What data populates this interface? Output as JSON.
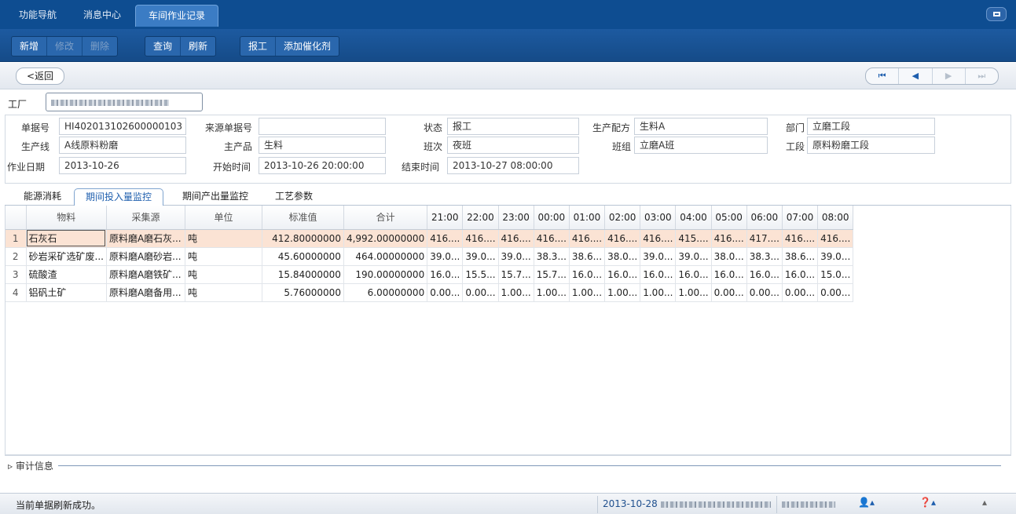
{
  "top_tabs": [
    "功能导航",
    "消息中心",
    "车间作业记录"
  ],
  "toolbar": {
    "group1": [
      {
        "label": "新增",
        "enabled": true
      },
      {
        "label": "修改",
        "enabled": false
      },
      {
        "label": "删除",
        "enabled": false
      }
    ],
    "group2": [
      {
        "label": "查询",
        "enabled": true
      },
      {
        "label": "刷新",
        "enabled": true
      }
    ],
    "group3": [
      {
        "label": "报工",
        "enabled": true
      },
      {
        "label": "添加催化剂",
        "enabled": true
      }
    ]
  },
  "nav": {
    "back_label": "<返回",
    "pager": [
      "⏮",
      "◀",
      "▶",
      "⏭"
    ]
  },
  "factory": {
    "label": "工厂"
  },
  "form": {
    "doc_no_label": "单据号",
    "doc_no": "HI402013102600000103",
    "source_no_label": "来源单据号",
    "source_no": "",
    "status_label": "状态",
    "status": "报工",
    "recipe_label": "生产配方",
    "recipe": "生料A",
    "dept_label": "部门",
    "dept": "立磨工段",
    "line_label": "生产线",
    "line": "A线原料粉磨",
    "product_label": "主产品",
    "product": "生料",
    "shift_label": "班次",
    "shift": "夜班",
    "team_label": "班组",
    "team": "立磨A班",
    "section_label": "工段",
    "section": "原料粉磨工段",
    "date_label": "作业日期",
    "date": "2013-10-26",
    "start_label": "开始时间",
    "start": "2013-10-26 20:00:00",
    "end_label": "结束时间",
    "end": "2013-10-27 08:00:00"
  },
  "sub_tabs": [
    "能源消耗",
    "期间投入量监控",
    "期间产出量监控",
    "工艺参数"
  ],
  "grid": {
    "headers": [
      "物料",
      "采集源",
      "单位",
      "标准值",
      "合计",
      "21:00",
      "22:00",
      "23:00",
      "00:00",
      "01:00",
      "02:00",
      "03:00",
      "04:00",
      "05:00",
      "06:00",
      "07:00",
      "08:00"
    ],
    "rows": [
      [
        "1",
        "石灰石",
        "原料磨A磨石灰...",
        "吨",
        "412.80000000",
        "4,992.00000000",
        "416....",
        "416....",
        "416....",
        "416....",
        "416....",
        "416....",
        "416....",
        "415....",
        "416....",
        "417....",
        "416....",
        "416...."
      ],
      [
        "2",
        "砂岩采矿选矿废...",
        "原料磨A磨砂岩...",
        "吨",
        "45.60000000",
        "464.00000000",
        "39.0...",
        "39.0...",
        "39.0...",
        "38.3...",
        "38.6...",
        "38.0...",
        "39.0...",
        "39.0...",
        "38.0...",
        "38.3...",
        "38.6...",
        "39.0..."
      ],
      [
        "3",
        "硫酸渣",
        "原料磨A磨铁矿...",
        "吨",
        "15.84000000",
        "190.00000000",
        "16.0...",
        "15.5...",
        "15.7...",
        "15.7...",
        "16.0...",
        "16.0...",
        "16.0...",
        "16.0...",
        "16.0...",
        "16.0...",
        "16.0...",
        "15.0..."
      ],
      [
        "4",
        "铝矾土矿",
        "原料磨A磨备用...",
        "吨",
        "5.76000000",
        "6.00000000",
        "0.00...",
        "0.00...",
        "1.00...",
        "1.00...",
        "1.00...",
        "1.00...",
        "1.00...",
        "1.00...",
        "0.00...",
        "0.00...",
        "0.00...",
        "0.00..."
      ]
    ]
  },
  "audit": {
    "label": "审计信息"
  },
  "status": {
    "message": "当前单据刷新成功。",
    "date": "2013-10-28"
  }
}
